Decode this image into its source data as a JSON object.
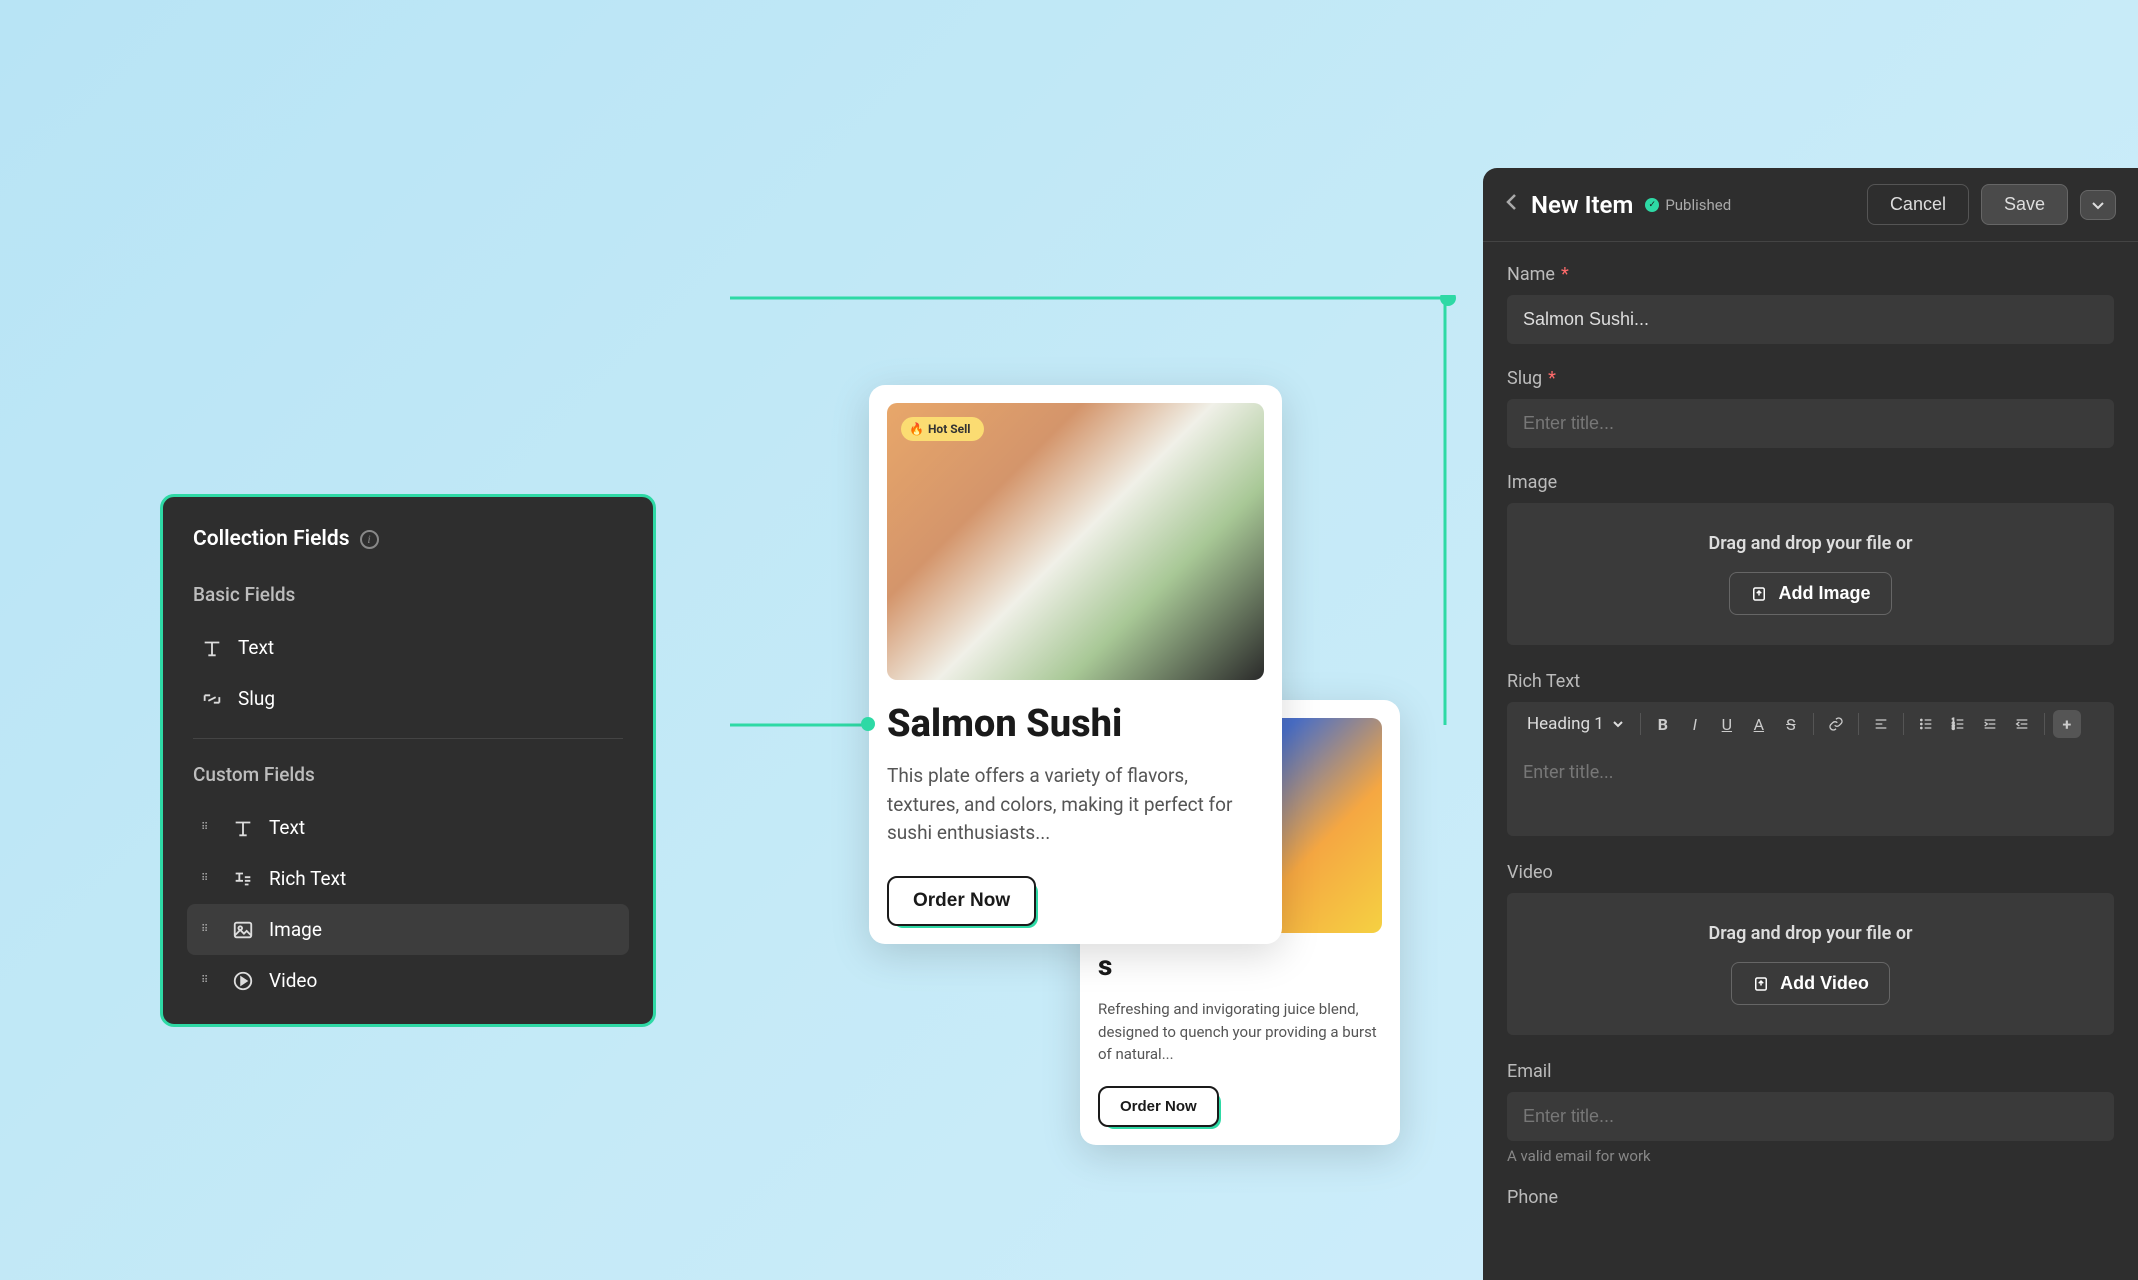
{
  "fields_panel": {
    "title": "Collection Fields",
    "basic_section": "Basic Fields",
    "custom_section": "Custom Fields",
    "basic_items": [
      {
        "label": "Text",
        "icon": "text-icon"
      },
      {
        "label": "Slug",
        "icon": "slug-icon"
      }
    ],
    "custom_items": [
      {
        "label": "Text",
        "icon": "text-icon",
        "highlighted": false
      },
      {
        "label": "Rich Text",
        "icon": "rich-text-icon",
        "highlighted": false
      },
      {
        "label": "Image",
        "icon": "image-icon",
        "highlighted": true
      },
      {
        "label": "Video",
        "icon": "video-icon",
        "highlighted": false
      }
    ]
  },
  "card_main": {
    "badge": "Hot Sell",
    "title": "Salmon Sushi",
    "description": "This plate offers a variety of flavors, textures, and colors, making it perfect for sushi enthusiasts...",
    "cta": "Order Now"
  },
  "card_secondary": {
    "title": "s",
    "description": "Refreshing and invigorating juice blend, designed to quench your providing a burst of natural...",
    "cta": "Order Now"
  },
  "editor": {
    "header": {
      "title": "New Item",
      "status": "Published",
      "cancel": "Cancel",
      "save": "Save"
    },
    "fields": {
      "name_label": "Name",
      "name_value": "Salmon Sushi...",
      "slug_label": "Slug",
      "slug_placeholder": "Enter title...",
      "image_label": "Image",
      "image_dropzone": "Drag and drop your file or",
      "image_button": "Add Image",
      "richtext_label": "Rich Text",
      "richtext_heading_select": "Heading 1",
      "richtext_placeholder": "Enter title...",
      "video_label": "Video",
      "video_dropzone": "Drag and drop your file or",
      "video_button": "Add Video",
      "email_label": "Email",
      "email_placeholder": "Enter title...",
      "email_helper": "A valid email for work",
      "phone_label": "Phone"
    }
  }
}
